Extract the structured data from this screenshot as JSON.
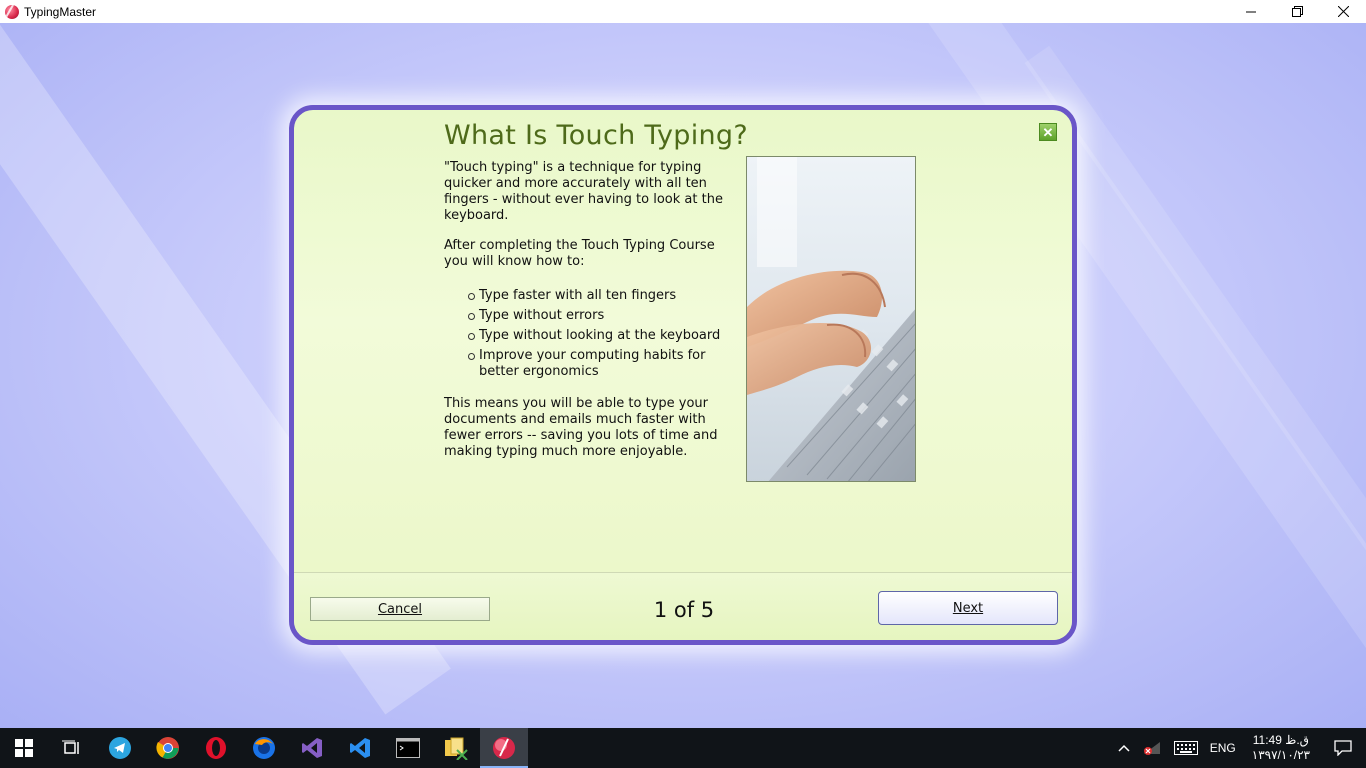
{
  "window": {
    "title": "TypingMaster",
    "minimize": "—",
    "restore": "❐",
    "close": "✕"
  },
  "dialog": {
    "title": "What Is Touch Typing?",
    "close_label": "✕",
    "paragraph1": "\"Touch typing\" is a technique for typing quicker and more accurately with all ten fingers - without ever having to look at the keyboard.",
    "paragraph2": "After completing the Touch Typing Course you will know how to:",
    "bullets": [
      "Type faster with all ten fingers",
      "Type without errors",
      "Type without looking at the keyboard",
      "Improve your computing habits for better ergonomics"
    ],
    "paragraph3": "This means you will be able to type your documents and emails much faster with fewer errors -- saving you lots of time and making typing much more enjoyable.",
    "image": "hands-typing-on-keyboard-photo"
  },
  "footer": {
    "cancel_label": "Cancel",
    "page_indicator": "1 of 5",
    "next_label": "Next"
  },
  "taskbar": {
    "items": [
      "start-icon",
      "task-view-icon",
      "telegram-icon",
      "chrome-icon",
      "opera-icon",
      "firefox-icon",
      "visual-studio-icon",
      "vscode-icon",
      "terminal-icon",
      "file-tool-icon",
      "typingmaster-icon"
    ],
    "active_item": "typingmaster-icon",
    "language": "ENG",
    "time": "11:49 ق.ظ",
    "date": "۱۳۹۷/۱۰/۲۳"
  },
  "colors": {
    "dialog_border": "#6a56c8",
    "title_green": "#4e6a1a",
    "background": "#c9ccfb"
  }
}
